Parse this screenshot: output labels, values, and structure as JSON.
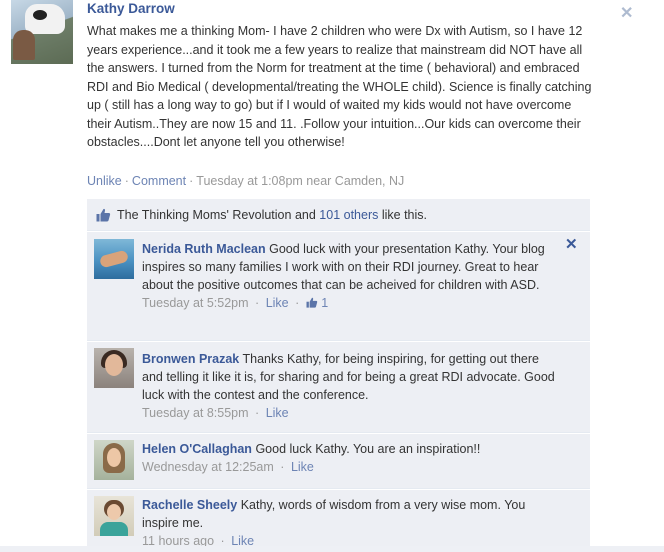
{
  "post": {
    "author": "Kathy Darrow",
    "message": "What makes me a thinking Mom- I have 2 children who were Dx with Autism, so I have 12 years experience...and it took me a few years to realize that mainstream did NOT have all the answers. I turned from the Norm for treatment at the time ( behavioral) and embraced RDI and Bio Medical ( developmental/treating the WHOLE child). Science is finally catching up ( still has a long way to go) but if I would of waited my kids would not have overcome their Autism..They are now 15 and 11. .Follow your intuition...Our kids can overcome their obstacles....Dont let anyone tell you otherwise!",
    "unlike_label": "Unlike",
    "comment_label": "Comment",
    "timestamp": "Tuesday at 1:08pm near Camden, NJ",
    "close_glyph": "✕"
  },
  "likes": {
    "page_name": "The Thinking Moms' Revolution",
    "and_text": "and",
    "others_link": "101 others",
    "suffix": "like this."
  },
  "comments": [
    {
      "name": "Nerida Ruth Maclean",
      "text": "Good luck with your presentation Kathy. Your blog inspires so many families I work with on their RDI journey. Great to hear about the positive outcomes that can be acheived for children with ASD.",
      "time": "Tuesday at 5:52pm",
      "like_label": "Like",
      "like_count": "1"
    },
    {
      "name": "Bronwen Prazak",
      "text": "Thanks Kathy, for being inspiring, for getting out there and telling it like it is, for sharing and for being a great RDI advocate. Good luck with the contest and the conference.",
      "time": "Tuesday at 8:55pm",
      "like_label": "Like"
    },
    {
      "name": "Helen O'Callaghan",
      "text": "Good luck Kathy. You are an inspiration!!",
      "time": "Wednesday at 12:25am",
      "like_label": "Like"
    },
    {
      "name": "Rachelle Sheely",
      "text": "Kathy, words of wisdom from a very wise mom. You inspire me.",
      "time": "11 hours ago",
      "like_label": "Like"
    }
  ],
  "colors": {
    "link": "#3b5998",
    "meta": "#999999",
    "ufi_bg": "#edeff4"
  },
  "icons": [
    "close-icon",
    "thumbs-up-icon",
    "delete-comment-icon"
  ]
}
